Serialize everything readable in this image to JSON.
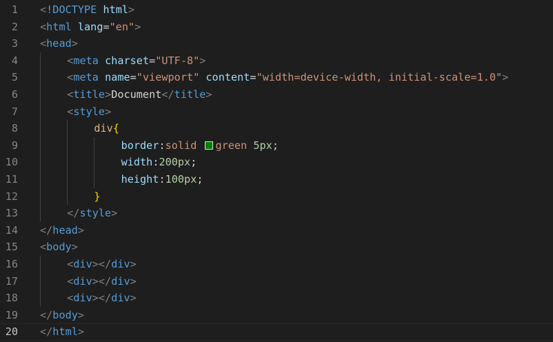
{
  "editor": {
    "current_line": 20,
    "swatch_color": "#008000",
    "lines": [
      {
        "n": "1",
        "indent": 0,
        "tokens": [
          [
            "punc",
            "<"
          ],
          [
            "tag",
            "!DOCTYPE"
          ],
          [
            "text",
            " "
          ],
          [
            "attr",
            "html"
          ],
          [
            "punc",
            ">"
          ]
        ]
      },
      {
        "n": "2",
        "indent": 0,
        "tokens": [
          [
            "punc",
            "<"
          ],
          [
            "tag",
            "html"
          ],
          [
            "text",
            " "
          ],
          [
            "attr",
            "lang"
          ],
          [
            "text",
            "="
          ],
          [
            "str",
            "\"en\""
          ],
          [
            "punc",
            ">"
          ]
        ]
      },
      {
        "n": "3",
        "indent": 0,
        "tokens": [
          [
            "punc",
            "<"
          ],
          [
            "tag",
            "head"
          ],
          [
            "punc",
            ">"
          ]
        ]
      },
      {
        "n": "4",
        "indent": 1,
        "tokens": [
          [
            "punc",
            "<"
          ],
          [
            "tag",
            "meta"
          ],
          [
            "text",
            " "
          ],
          [
            "attr",
            "charset"
          ],
          [
            "text",
            "="
          ],
          [
            "str",
            "\"UTF-8\""
          ],
          [
            "punc",
            ">"
          ]
        ]
      },
      {
        "n": "5",
        "indent": 1,
        "tokens": [
          [
            "punc",
            "<"
          ],
          [
            "tag",
            "meta"
          ],
          [
            "text",
            " "
          ],
          [
            "attr",
            "name"
          ],
          [
            "text",
            "="
          ],
          [
            "str",
            "\"viewport\""
          ],
          [
            "text",
            " "
          ],
          [
            "attr",
            "content"
          ],
          [
            "text",
            "="
          ],
          [
            "str",
            "\"width=device-width, initial-scale=1.0\""
          ],
          [
            "punc",
            ">"
          ]
        ]
      },
      {
        "n": "6",
        "indent": 1,
        "tokens": [
          [
            "punc",
            "<"
          ],
          [
            "tag",
            "title"
          ],
          [
            "punc",
            ">"
          ],
          [
            "text",
            "Document"
          ],
          [
            "punc",
            "</"
          ],
          [
            "tag",
            "title"
          ],
          [
            "punc",
            ">"
          ]
        ]
      },
      {
        "n": "7",
        "indent": 1,
        "tokens": [
          [
            "punc",
            "<"
          ],
          [
            "tag",
            "style"
          ],
          [
            "punc",
            ">"
          ]
        ]
      },
      {
        "n": "8",
        "indent": 2,
        "tokens": [
          [
            "sel",
            "div"
          ],
          [
            "brace",
            "{"
          ]
        ]
      },
      {
        "n": "9",
        "indent": 3,
        "tokens": [
          [
            "prop",
            "border"
          ],
          [
            "text",
            ":"
          ],
          [
            "val",
            "solid "
          ],
          [
            "swatch",
            ""
          ],
          [
            "val",
            "green "
          ],
          [
            "num",
            "5px"
          ],
          [
            "text",
            ";"
          ]
        ]
      },
      {
        "n": "10",
        "indent": 3,
        "tokens": [
          [
            "prop",
            "width"
          ],
          [
            "text",
            ":"
          ],
          [
            "num",
            "200px"
          ],
          [
            "text",
            ";"
          ]
        ]
      },
      {
        "n": "11",
        "indent": 3,
        "tokens": [
          [
            "prop",
            "height"
          ],
          [
            "text",
            ":"
          ],
          [
            "num",
            "100px"
          ],
          [
            "text",
            ";"
          ]
        ]
      },
      {
        "n": "12",
        "indent": 2,
        "tokens": [
          [
            "brace",
            "}"
          ]
        ]
      },
      {
        "n": "13",
        "indent": 1,
        "tokens": [
          [
            "punc",
            "</"
          ],
          [
            "tag",
            "style"
          ],
          [
            "punc",
            ">"
          ]
        ]
      },
      {
        "n": "14",
        "indent": 0,
        "tokens": [
          [
            "punc",
            "</"
          ],
          [
            "tag",
            "head"
          ],
          [
            "punc",
            ">"
          ]
        ]
      },
      {
        "n": "15",
        "indent": 0,
        "tokens": [
          [
            "punc",
            "<"
          ],
          [
            "tag",
            "body"
          ],
          [
            "punc",
            ">"
          ]
        ]
      },
      {
        "n": "16",
        "indent": 1,
        "tokens": [
          [
            "punc",
            "<"
          ],
          [
            "tag",
            "div"
          ],
          [
            "punc",
            "></"
          ],
          [
            "tag",
            "div"
          ],
          [
            "punc",
            ">"
          ]
        ]
      },
      {
        "n": "17",
        "indent": 1,
        "tokens": [
          [
            "punc",
            "<"
          ],
          [
            "tag",
            "div"
          ],
          [
            "punc",
            "></"
          ],
          [
            "tag",
            "div"
          ],
          [
            "punc",
            ">"
          ]
        ]
      },
      {
        "n": "18",
        "indent": 1,
        "tokens": [
          [
            "punc",
            "<"
          ],
          [
            "tag",
            "div"
          ],
          [
            "punc",
            "></"
          ],
          [
            "tag",
            "div"
          ],
          [
            "punc",
            ">"
          ]
        ]
      },
      {
        "n": "19",
        "indent": 0,
        "tokens": [
          [
            "punc",
            "</"
          ],
          [
            "tag",
            "body"
          ],
          [
            "punc",
            ">"
          ]
        ]
      },
      {
        "n": "20",
        "indent": 0,
        "tokens": [
          [
            "punc",
            "</"
          ],
          [
            "tag",
            "html"
          ],
          [
            "punc",
            ">"
          ]
        ]
      }
    ]
  }
}
